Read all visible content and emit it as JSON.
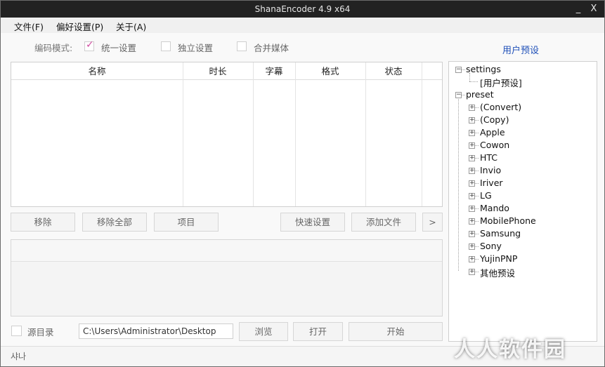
{
  "window": {
    "title": "ShanaEncoder 4.9 x64",
    "minimize_label": "_",
    "close_label": "X"
  },
  "menu": {
    "items": [
      {
        "label": "文件(F)"
      },
      {
        "label": "偏好设置(P)"
      },
      {
        "label": "关于(A)"
      }
    ]
  },
  "encode_mode": {
    "label": "编码模式:",
    "options": [
      {
        "label": "统一设置",
        "checked": true
      },
      {
        "label": "独立设置",
        "checked": false
      },
      {
        "label": "合并媒体",
        "checked": false
      }
    ]
  },
  "file_table": {
    "columns": [
      "名称",
      "时长",
      "字幕",
      "格式",
      "状态"
    ],
    "rows": []
  },
  "buttons": {
    "remove": "移除",
    "remove_all": "移除全部",
    "item": "项目",
    "quick_settings": "快速设置",
    "add_file": "添加文件",
    "more": ">",
    "browse": "浏览",
    "open": "打开",
    "start": "开始"
  },
  "output": {
    "source_dir_label": "源目录",
    "source_dir_checked": false,
    "path_value": "C:\\Users\\Administrator\\Desktop"
  },
  "presets": {
    "title": "用户预设",
    "tree": {
      "settings_label": "settings",
      "user_preset_label": "[用户预设]",
      "preset_label": "preset",
      "children": [
        "(Convert)",
        "(Copy)",
        "Apple",
        "Cowon",
        "HTC",
        "Invio",
        "Iriver",
        "LG",
        "Mando",
        "MobilePhone",
        "Samsung",
        "Sony",
        "YujinPNP",
        "其他预设"
      ]
    }
  },
  "status": {
    "text": "샤나"
  },
  "watermark": {
    "text": "人人软件园"
  },
  "colors": {
    "titlebar": "#222222",
    "accent_blue": "#1e4fb8",
    "check_mark": "#d14fa3"
  }
}
